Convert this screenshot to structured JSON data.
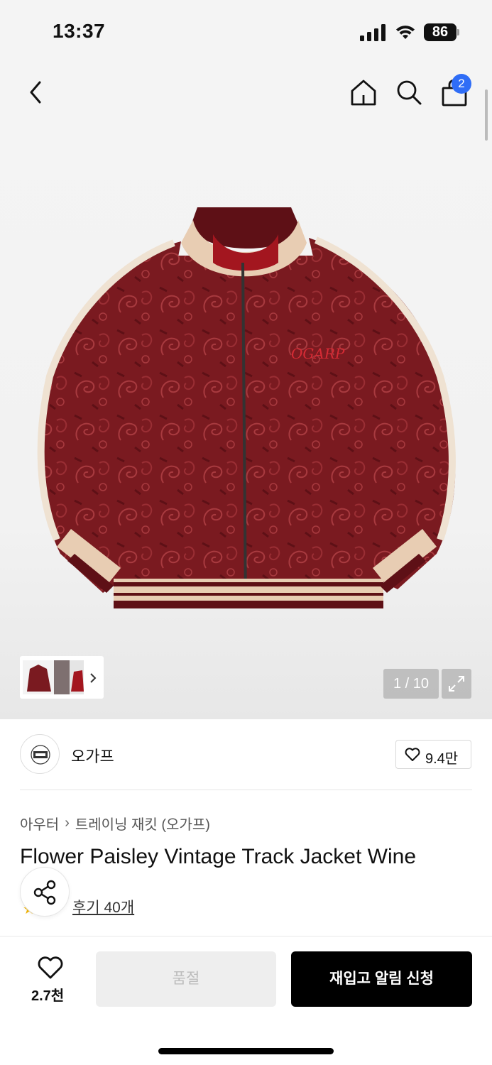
{
  "status_bar": {
    "time": "13:37",
    "battery": "86",
    "icons": [
      "cellular-signal-icon",
      "wifi-icon",
      "battery-icon"
    ]
  },
  "nav": {
    "icons": [
      "back-arrow-icon",
      "home-icon",
      "search-icon",
      "cart-icon"
    ],
    "cart_badge": "2"
  },
  "gallery": {
    "counter": "1 / 10",
    "icons": [
      "chevron-right-icon",
      "fullscreen-icon"
    ]
  },
  "brand": {
    "name": "오가프",
    "likes": "9.4만"
  },
  "product": {
    "breadcrumb": [
      "아우터",
      "트레이닝 재킷 (오가프)"
    ],
    "title": "Flower Paisley Vintage Track Jacket Wine",
    "review_link": "후기 40개"
  },
  "bottom_bar": {
    "wish_count": "2.7천",
    "soldout_label": "품절",
    "restock_label": "재입고 알림 신청"
  },
  "colors": {
    "badge": "#2f6df6",
    "primary_button": "#000000",
    "disabled_button": "#eeeeee",
    "jacket": "#7a1a20"
  }
}
